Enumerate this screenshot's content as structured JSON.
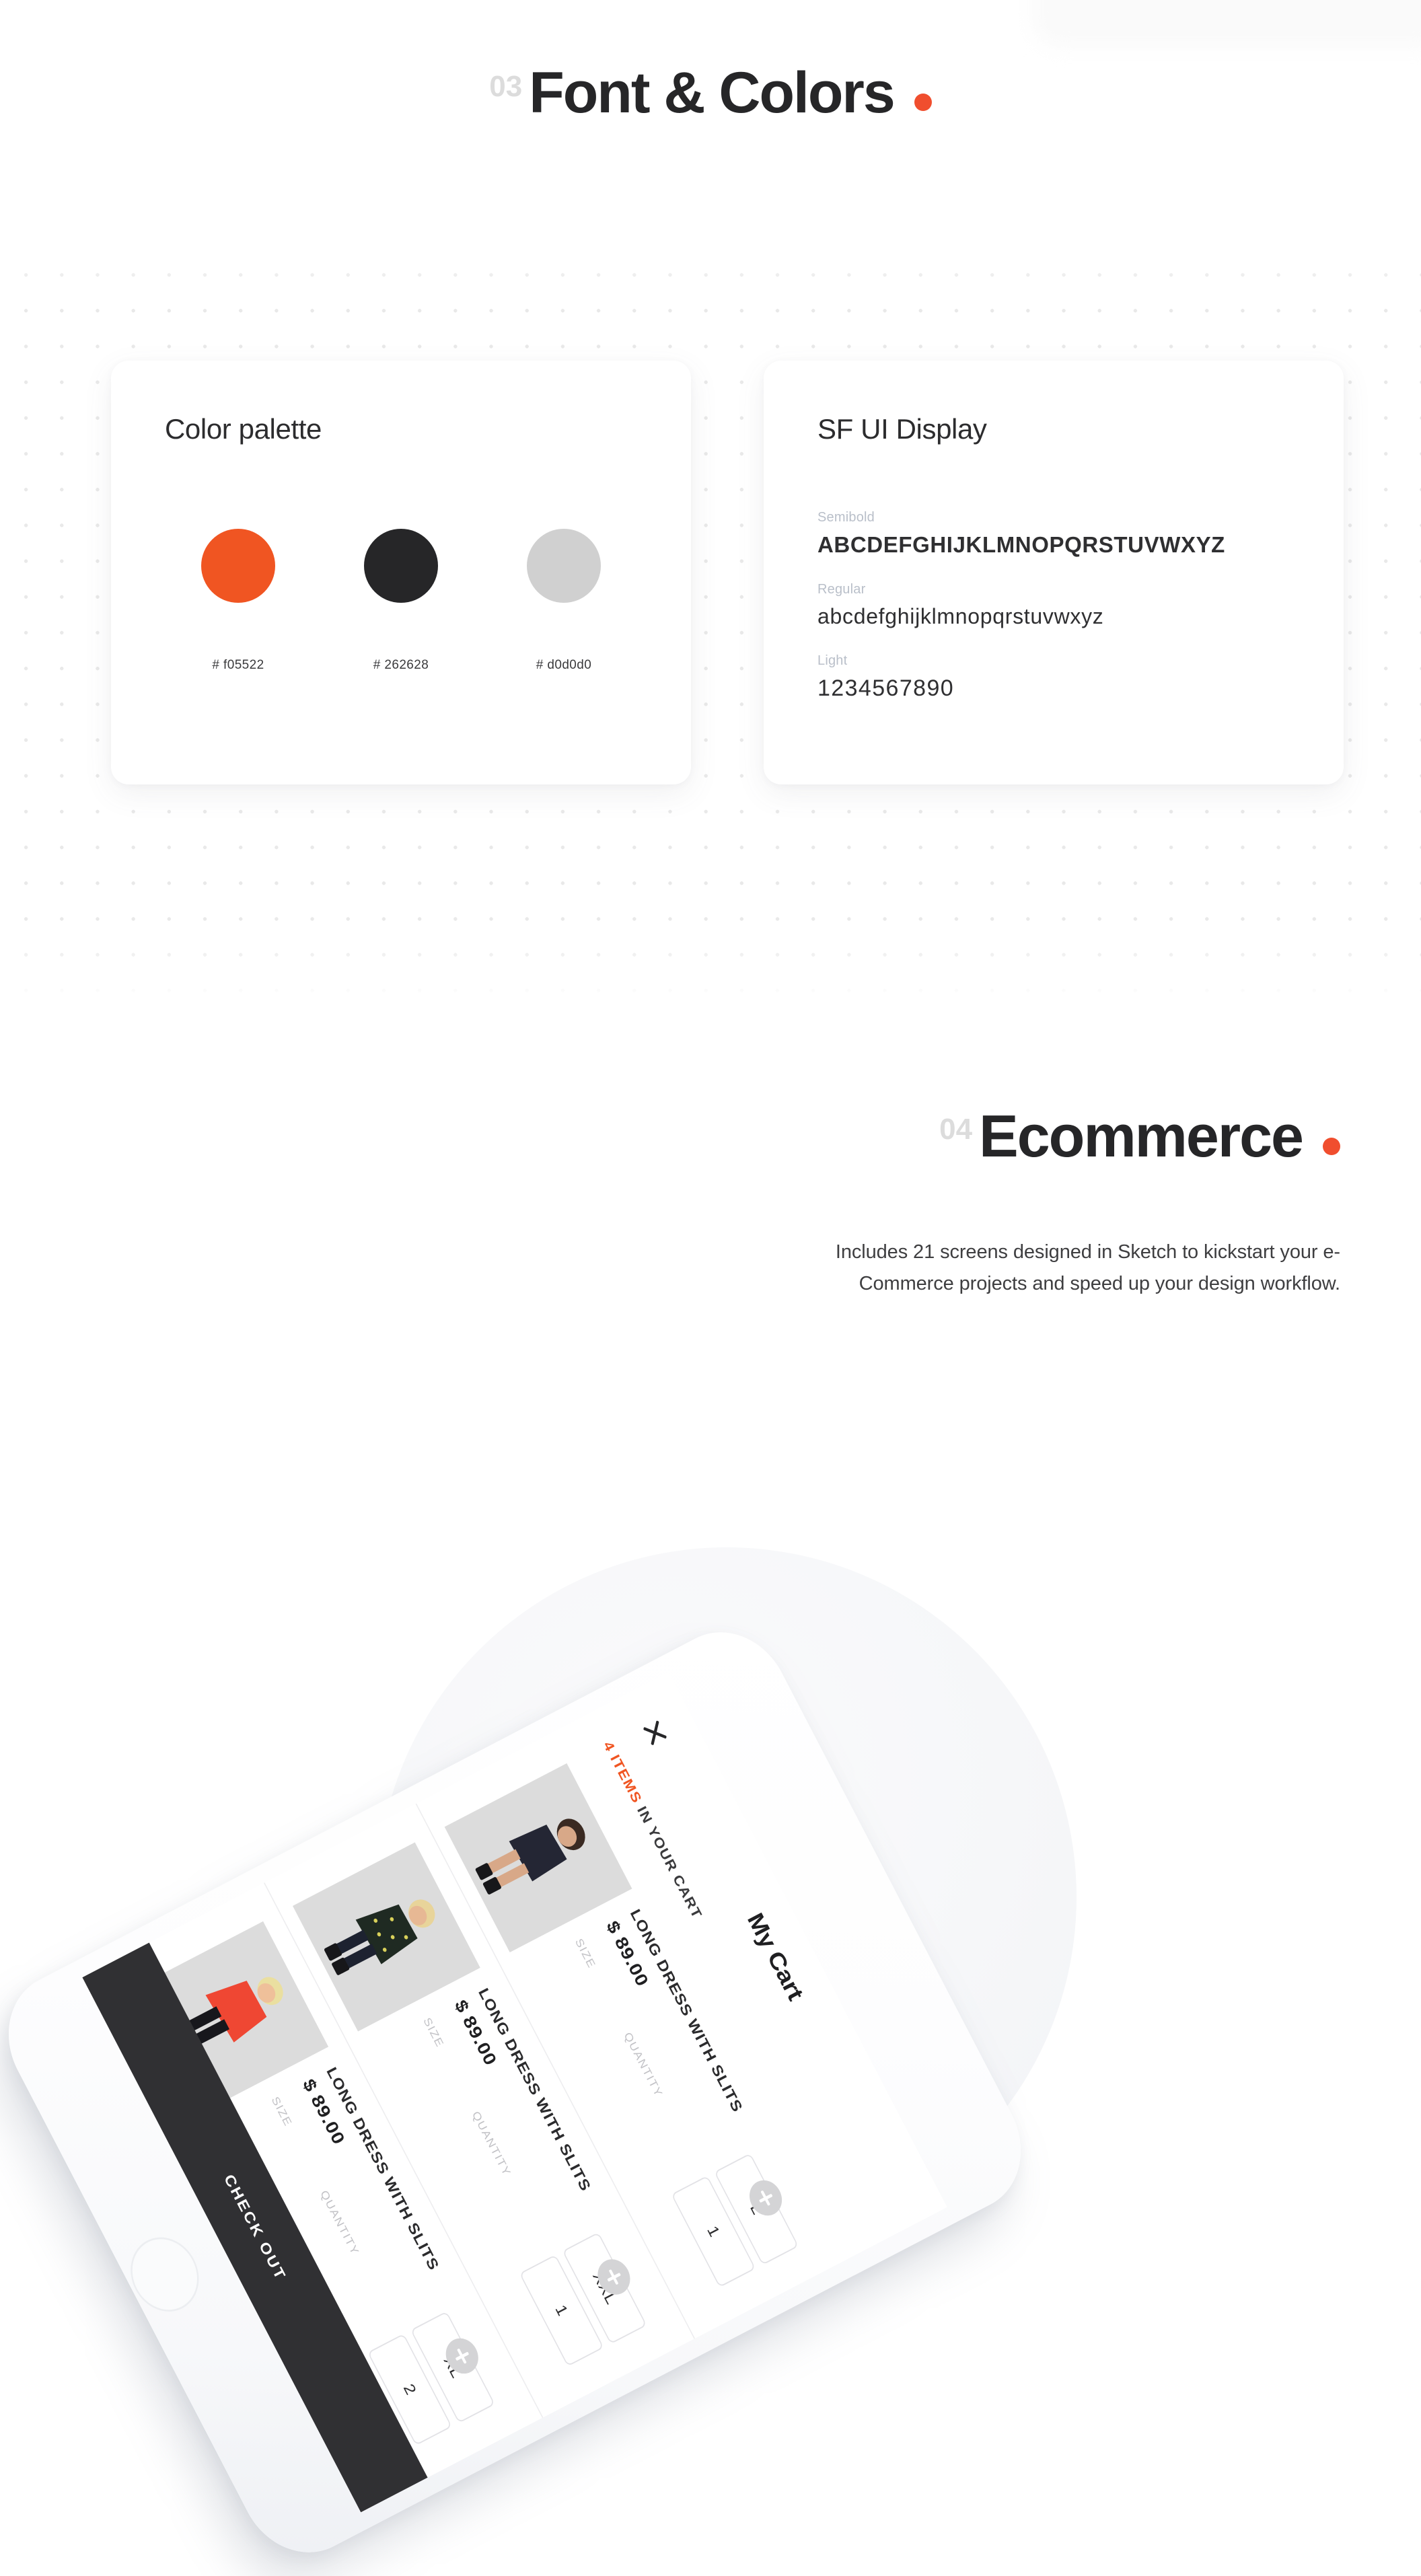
{
  "sections": [
    {
      "number": "03",
      "title": "Font & Colors",
      "accent": "#f05522"
    },
    {
      "number": "04",
      "title": "Ecommerce",
      "accent": "#f05522"
    }
  ],
  "font_colors_section": {
    "number": "03",
    "title": "Font & Colors",
    "palette_card": {
      "title": "Color palette",
      "swatches": [
        {
          "hex_label": "# f05522",
          "color": "#f05522"
        },
        {
          "hex_label": "# 262628",
          "color": "#262628"
        },
        {
          "hex_label": "# d0d0d0",
          "color": "#d0d0d0"
        }
      ]
    },
    "typography_card": {
      "title": "SF UI Display",
      "specimens": [
        {
          "weight_label": "Semibold",
          "sample": "ABCDEFGHIJKLMNOPQRSTUVWXYZ"
        },
        {
          "weight_label": "Regular",
          "sample": "abcdefghijklmnopqrstuvwxyz"
        },
        {
          "weight_label": "Light",
          "sample": "1234567890"
        }
      ]
    }
  },
  "ecommerce_section": {
    "number": "04",
    "title": "Ecommerce",
    "description": "Includes 21 screens designed in Sketch to kickstart your e-Commerce projects and speed up your design workflow."
  },
  "phone_mockup": {
    "screen": {
      "title": "My Cart",
      "close_icon": "close-icon",
      "subtitle_highlight": "4 ITEMS",
      "subtitle_rest": " IN YOUR CART",
      "size_label": "SIZE",
      "quantity_label": "QUANTITY",
      "add_icon": "plus-icon",
      "checkout_label": "CHECK OUT",
      "items": [
        {
          "name": "LONG DRESS WITH SLITS",
          "price": "$ 89.00",
          "size": "L",
          "quantity": "1"
        },
        {
          "name": "LONG DRESS WITH SLITS",
          "price": "$ 89.00",
          "size": "XXL",
          "quantity": "1"
        },
        {
          "name": "LONG DRESS WITH SLITS",
          "price": "$ 89.00",
          "size": "XL",
          "quantity": "2"
        }
      ]
    }
  }
}
